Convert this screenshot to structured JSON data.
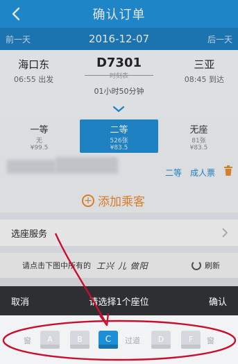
{
  "header": {
    "title": "确认订单"
  },
  "datebar": {
    "prev": "前一天",
    "date": "2016-12-07",
    "next": "后一天"
  },
  "train": {
    "from": {
      "station": "海口东",
      "time": "06:55 出发"
    },
    "number": "D7301",
    "sub": "时刻表",
    "duration": "01小时50分钟",
    "to": {
      "station": "三亚",
      "time": "08:45 到达"
    }
  },
  "seat_types": [
    {
      "name": "一等",
      "count": "无",
      "price": "¥99.5",
      "selected": false
    },
    {
      "name": "二等",
      "count": "526张",
      "price": "¥83.5",
      "selected": true
    },
    {
      "name": "无座",
      "count": "81张",
      "price": "¥83.5",
      "selected": false
    }
  ],
  "passenger": {
    "seat": "二等",
    "ticket": "成人票",
    "add_label": "添加乘客"
  },
  "service": {
    "label": "选座服务"
  },
  "hint": {
    "text": "请点击下图中所有的",
    "captcha": "工兴  儿 做阳",
    "refresh": "刷新"
  },
  "sheet": {
    "cancel": "取消",
    "prompt": "请选择1个座位",
    "confirm": "确认"
  },
  "seat_map": {
    "window_left": "窗",
    "aisle": "过道",
    "window_right": "窗",
    "seats": [
      {
        "letter": "A",
        "selected": false
      },
      {
        "letter": "B",
        "selected": false
      },
      {
        "letter": "C",
        "selected": true
      },
      {
        "letter": "D",
        "selected": false
      },
      {
        "letter": "F",
        "selected": false
      }
    ]
  },
  "colors": {
    "header_bg": "#1d92dc",
    "accent": "#1d8fd6",
    "annotation": "#c8102e",
    "add_orange": "#f08a2b"
  }
}
